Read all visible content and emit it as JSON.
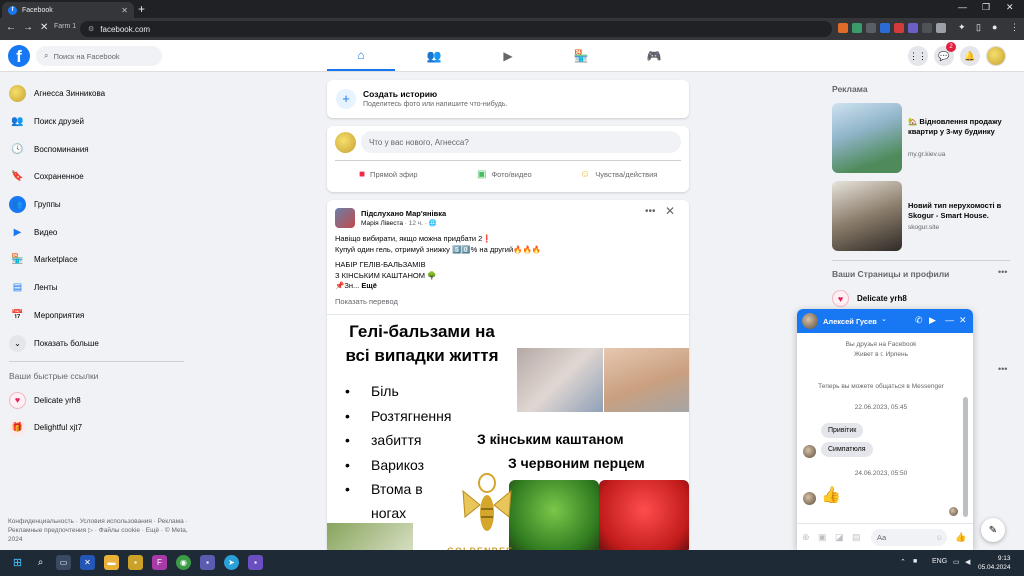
{
  "browser": {
    "tab_title": "Facebook",
    "profile_label": "Farm 1",
    "url": "facebook.com"
  },
  "fb": {
    "logo": "f",
    "search_placeholder": "Поиск на Facebook",
    "messenger_badge": "2",
    "nav_icons": [
      "home-icon",
      "friends-icon",
      "watch-icon",
      "marketplace-icon",
      "gaming-icon"
    ]
  },
  "sidebar": {
    "items": [
      {
        "label": "Агнесса Зинникова",
        "icon": "avatar"
      },
      {
        "label": "Поиск друзей",
        "icon": "friends-icon"
      },
      {
        "label": "Воспоминания",
        "icon": "clock-icon"
      },
      {
        "label": "Сохраненное",
        "icon": "bookmark-icon"
      },
      {
        "label": "Группы",
        "icon": "groups-icon"
      },
      {
        "label": "Видео",
        "icon": "video-icon"
      },
      {
        "label": "Marketplace",
        "icon": "shop-icon"
      },
      {
        "label": "Ленты",
        "icon": "feeds-icon"
      },
      {
        "label": "Мероприятия",
        "icon": "calendar-icon"
      },
      {
        "label": "Показать больше",
        "icon": "chevron-down-icon"
      }
    ],
    "shortcuts_title": "Ваши быстрые ссылки",
    "shortcuts": [
      {
        "label": "Delicate yrh8"
      },
      {
        "label": "Delightful xjt7"
      }
    ],
    "footer": "Конфиденциальность · Условия использования · Реклама · Рекламные предпочтения ▷ · Файлы cookie · Ещё · © Meta, 2024"
  },
  "story": {
    "title": "Создать историю",
    "subtitle": "Поделитесь фото или напишите что-нибудь."
  },
  "composer": {
    "placeholder": "Что у вас нового, Агнесса?",
    "live": "Прямой эфир",
    "photo": "Фото/видео",
    "feeling": "Чувства/действия"
  },
  "post": {
    "author": "Підслухано Мар'янівка",
    "location": "Марія Лівеста",
    "time": " · 12 ч. · 🌐",
    "lines": [
      "Навіщо вибирати, якщо можна придбати 2❗",
      "Купуй один гель, отримуй знижку 5️⃣0️⃣% на другий🔥🔥🔥",
      "",
      "НАБІР ГЕЛІВ-БАЛЬЗАМІВ",
      "З КІНСЬКИМ КАШТАНОМ 🌳",
      "📌Зн..."
    ],
    "more": "Ещё",
    "translate": "Показать перевод",
    "image": {
      "headline_1": "Гелі-бальзами на",
      "headline_2": "всі випадки життя",
      "bullets": [
        "Біль",
        "Розтягнення",
        "забиття",
        "Варикоз",
        "Втома в",
        "ногах"
      ],
      "tag_1": "З кінським каштаном",
      "tag_2": "З червоним перцем",
      "brand": "GOLDENBEE"
    }
  },
  "right": {
    "ads_title": "Реклама",
    "ads": [
      {
        "title": "🏡 Відновлення продажу квартир у 3-му будинку",
        "domain": "my.gr.kiev.ua"
      },
      {
        "title": "Новий тип нерухомості в Skogur - Smart House.",
        "domain": "skogur.site"
      }
    ],
    "pages_title": "Ваши Страницы и профили",
    "page_name": "Delicate yrh8"
  },
  "chat": {
    "name": "Алексей Гусев",
    "info_1": "Вы друзья на Facebook",
    "info_2": "Живет в г. Ирпень",
    "info_3": "Теперь вы можете общаться в Messenger",
    "date_1": "22.06.2023, 05:45",
    "msg_1": "Привітик",
    "msg_2": "Симпатюля",
    "date_2": "24.06.2023, 05:50",
    "input_placeholder": "Aa"
  },
  "taskbar": {
    "lang": "ENG",
    "time": "9:13",
    "date": "05.04.2024"
  },
  "colors": {
    "brand": "#1877f2",
    "badge": "#e41e3f",
    "page_bg": "#f0f2f5"
  }
}
